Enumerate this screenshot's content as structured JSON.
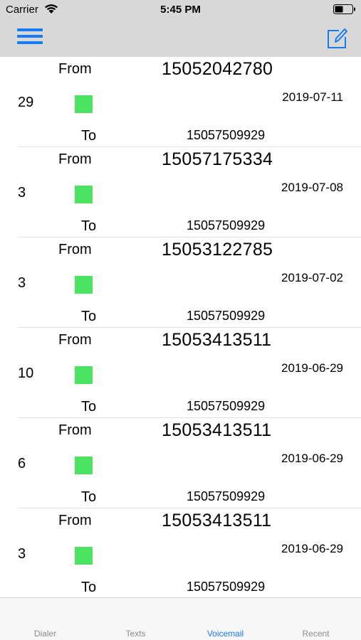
{
  "status_bar": {
    "carrier": "Carrier",
    "time": "5:45 PM"
  },
  "nav": {
    "menu_icon": "hamburger-menu-icon",
    "compose_icon": "compose-icon",
    "accent": "#1a7cf5"
  },
  "entries": [
    {
      "from_label": "From",
      "from_number": "15052042780",
      "count": "29",
      "date": "2019-07-11",
      "to_label": "To",
      "to_number": "15057509929",
      "status_color": "#4be35f"
    },
    {
      "from_label": "From",
      "from_number": "15057175334",
      "count": "3",
      "date": "2019-07-08",
      "to_label": "To",
      "to_number": "15057509929",
      "status_color": "#4be35f"
    },
    {
      "from_label": "From",
      "from_number": "15053122785",
      "count": "3",
      "date": "2019-07-02",
      "to_label": "To",
      "to_number": "15057509929",
      "status_color": "#4be35f"
    },
    {
      "from_label": "From",
      "from_number": "15053413511",
      "count": "10",
      "date": "2019-06-29",
      "to_label": "To",
      "to_number": "15057509929",
      "status_color": "#4be35f"
    },
    {
      "from_label": "From",
      "from_number": "15053413511",
      "count": "6",
      "date": "2019-06-29",
      "to_label": "To",
      "to_number": "15057509929",
      "status_color": "#4be35f"
    },
    {
      "from_label": "From",
      "from_number": "15053413511",
      "count": "3",
      "date": "2019-06-29",
      "to_label": "To",
      "to_number": "15057509929",
      "status_color": "#4be35f"
    }
  ],
  "tabs": [
    {
      "label": "Dialer",
      "active": false
    },
    {
      "label": "Texts",
      "active": false
    },
    {
      "label": "Voicemail",
      "active": true
    },
    {
      "label": "Recent",
      "active": false
    }
  ]
}
